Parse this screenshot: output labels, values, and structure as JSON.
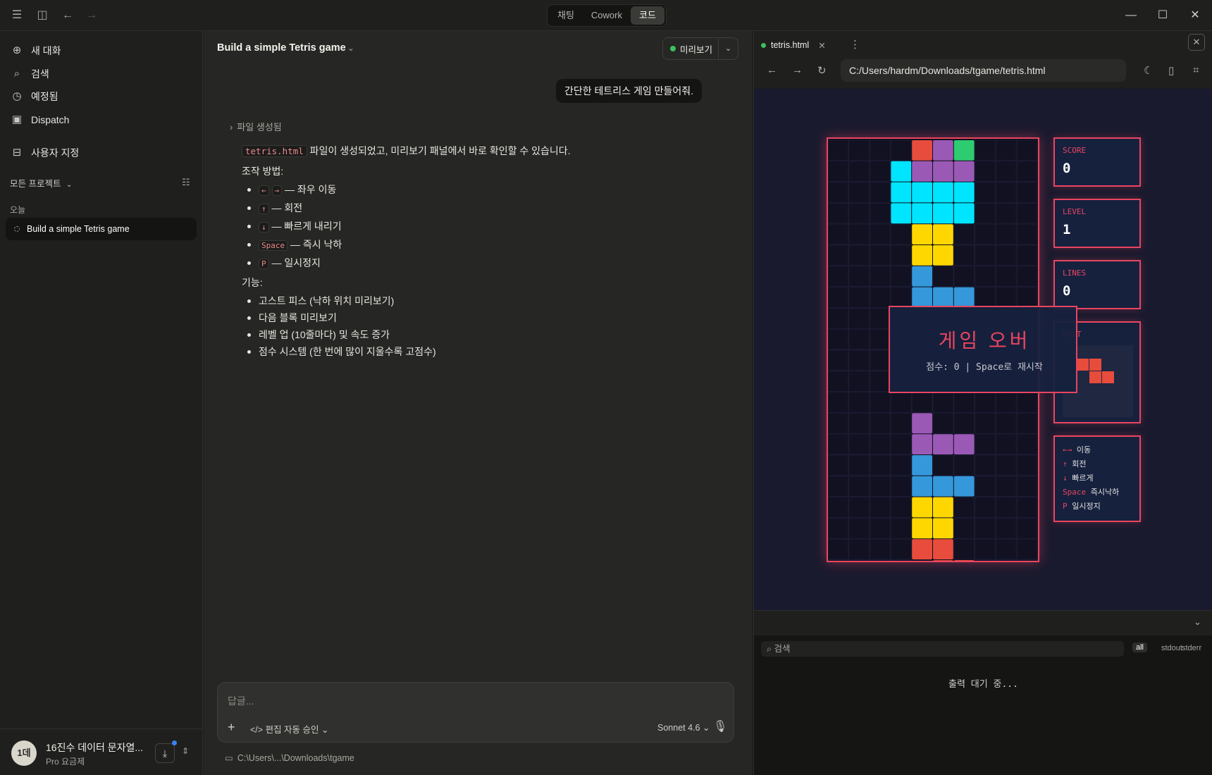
{
  "titlebar": {
    "modes": [
      {
        "label": "채팅",
        "active": false
      },
      {
        "label": "Cowork",
        "active": false
      },
      {
        "label": "코드",
        "active": true
      }
    ]
  },
  "sidebar": {
    "items": [
      {
        "label": "새 대화",
        "icon": "plus-icon"
      },
      {
        "label": "검색",
        "icon": "search-icon"
      },
      {
        "label": "예정됨",
        "icon": "clock-icon"
      },
      {
        "label": "Dispatch",
        "icon": "dispatch-icon"
      },
      {
        "label": "사용자 지정",
        "icon": "briefcase-icon"
      }
    ],
    "projects_label": "모든 프로젝트",
    "today_label": "오늘",
    "conversation": "Build a simple Tetris game",
    "user": {
      "initials": "1데",
      "name": "16진수 데이터 문자열...",
      "plan": "Pro 요금제"
    }
  },
  "chat": {
    "title": "Build a simple Tetris game",
    "preview_label": "미리보기",
    "user_message": "간단한 테트리스 게임 만들어줘.",
    "file_created": "파일 생성됨",
    "intro_code": "tetris.html",
    "intro_text": " 파일이 생성되었고, 미리보기 패널에서 바로 확인할 수 있습니다.",
    "controls_heading": "조작 방법:",
    "controls": [
      {
        "keys": [
          "←",
          "→"
        ],
        "desc": " — 좌우 이동"
      },
      {
        "keys": [
          "↑"
        ],
        "desc": " — 회전"
      },
      {
        "keys": [
          "↓"
        ],
        "desc": " — 빠르게 내리기"
      },
      {
        "keys": [
          "Space"
        ],
        "desc": " — 즉시 낙하"
      },
      {
        "keys": [
          "P"
        ],
        "desc": " — 일시정지"
      }
    ],
    "features_heading": "기능:",
    "features": [
      "고스트 피스 (낙하 위치 미리보기)",
      "다음 블록 미리보기",
      "레벨 업 (10줄마다) 및 속도 증가",
      "점수 시스템 (한 번에 많이 지울수록 고점수)"
    ],
    "composer_placeholder": "답글...",
    "auto_approve": "편집 자동 승인",
    "model": "Sonnet 4.6",
    "path": "C:\\Users\\...\\Downloads\\tgame"
  },
  "preview": {
    "tab_label": "tetris.html",
    "url": "C:/Users/hardm/Downloads/tgame/tetris.html",
    "score_label": "SCORE",
    "score": "0",
    "level_label": "LEVEL",
    "level": "1",
    "lines_label": "LINES",
    "lines": "0",
    "next_label": "NEXT",
    "game_over_title": "게임 오버",
    "game_over_sub": "점수: 0 | Space로 재시작",
    "controls": [
      {
        "key": "←→",
        "label": " 이동"
      },
      {
        "key": "↑",
        "label": " 회전"
      },
      {
        "key": "↓",
        "label": " 빠르게"
      },
      {
        "key": "Space",
        "label": " 즉시낙하"
      },
      {
        "key": "P",
        "label": " 일시정지"
      }
    ],
    "console_search": "검색",
    "filters": [
      "all",
      "stdout",
      "stderr"
    ],
    "waiting": "출력 대기 중...",
    "colors": {
      "I": "#00e5ff",
      "O": "#ffd700",
      "T": "#9b59b6",
      "J": "#3498db",
      "S": "#2ecc71",
      "Z": "#e74c3c"
    },
    "board": [
      "....ZTS...",
      "...ITTT...",
      "...IIII...",
      "...IIII...",
      "....OO....",
      "....OO....",
      "....J.....",
      "....JJJ...",
      "..........",
      "..........",
      "..........",
      "..........",
      "..........",
      "....T.....",
      "....TTT...",
      "....J.....",
      "....JJJ...",
      "....OO....",
      "....OO....",
      "....ZZ....",
      ".....ZZ..."
    ],
    "next_piece": [
      "ZZ.",
      ".ZZ"
    ]
  }
}
